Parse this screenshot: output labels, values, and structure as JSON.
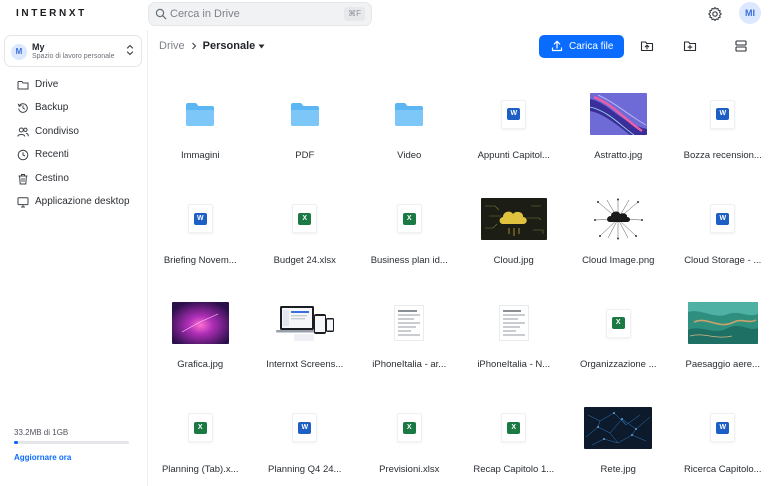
{
  "app": {
    "logo": "INTERNXT",
    "search_placeholder": "Cerca in Drive",
    "search_shortcut": "⌘F",
    "avatar_initials": "MI",
    "accent_color": "#0a6cff"
  },
  "workspace": {
    "initial": "M",
    "name": "My",
    "subtitle": "Spazio di lavoro personale"
  },
  "sidebar": {
    "items": [
      {
        "label": "Drive",
        "icon": "folder-icon"
      },
      {
        "label": "Backup",
        "icon": "history-icon"
      },
      {
        "label": "Condiviso",
        "icon": "users-icon"
      },
      {
        "label": "Recenti",
        "icon": "clock-icon"
      },
      {
        "label": "Cestino",
        "icon": "trash-icon"
      },
      {
        "label": "Applicazione desktop",
        "icon": "desktop-icon"
      }
    ],
    "storage_text": "33.2MB di 1GB",
    "storage_used_fraction": 0.033,
    "upgrade_label": "Aggiornare ora"
  },
  "breadcrumb": {
    "root": "Drive",
    "current": "Personale"
  },
  "toolbar": {
    "upload_label": "Carica file"
  },
  "files": [
    {
      "name": "Immagini",
      "kind": "folder"
    },
    {
      "name": "PDF",
      "kind": "folder"
    },
    {
      "name": "Video",
      "kind": "folder"
    },
    {
      "name": "Appunti Capitol...",
      "kind": "word"
    },
    {
      "name": "Astratto.jpg",
      "kind": "image"
    },
    {
      "name": "Bozza recension...",
      "kind": "word"
    },
    {
      "name": "Briefing Novem...",
      "kind": "word"
    },
    {
      "name": "Budget 24.xlsx",
      "kind": "excel"
    },
    {
      "name": "Business plan id...",
      "kind": "excel"
    },
    {
      "name": "Cloud.jpg",
      "kind": "image"
    },
    {
      "name": "Cloud Image.png",
      "kind": "image"
    },
    {
      "name": "Cloud Storage - ...",
      "kind": "word"
    },
    {
      "name": "Grafica.jpg",
      "kind": "image"
    },
    {
      "name": "Internxt Screens...",
      "kind": "image"
    },
    {
      "name": "iPhoneItalia - ar...",
      "kind": "document"
    },
    {
      "name": "iPhoneItalia - N...",
      "kind": "document"
    },
    {
      "name": "Organizzazione ...",
      "kind": "excel"
    },
    {
      "name": "Paesaggio aere...",
      "kind": "image"
    },
    {
      "name": "Planning (Tab).x...",
      "kind": "excel"
    },
    {
      "name": "Planning Q4 24...",
      "kind": "word"
    },
    {
      "name": "Previsioni.xlsx",
      "kind": "excel"
    },
    {
      "name": "Recap Capitolo 1...",
      "kind": "excel"
    },
    {
      "name": "Rete.jpg",
      "kind": "image"
    },
    {
      "name": "Ricerca Capitolo...",
      "kind": "word"
    }
  ]
}
